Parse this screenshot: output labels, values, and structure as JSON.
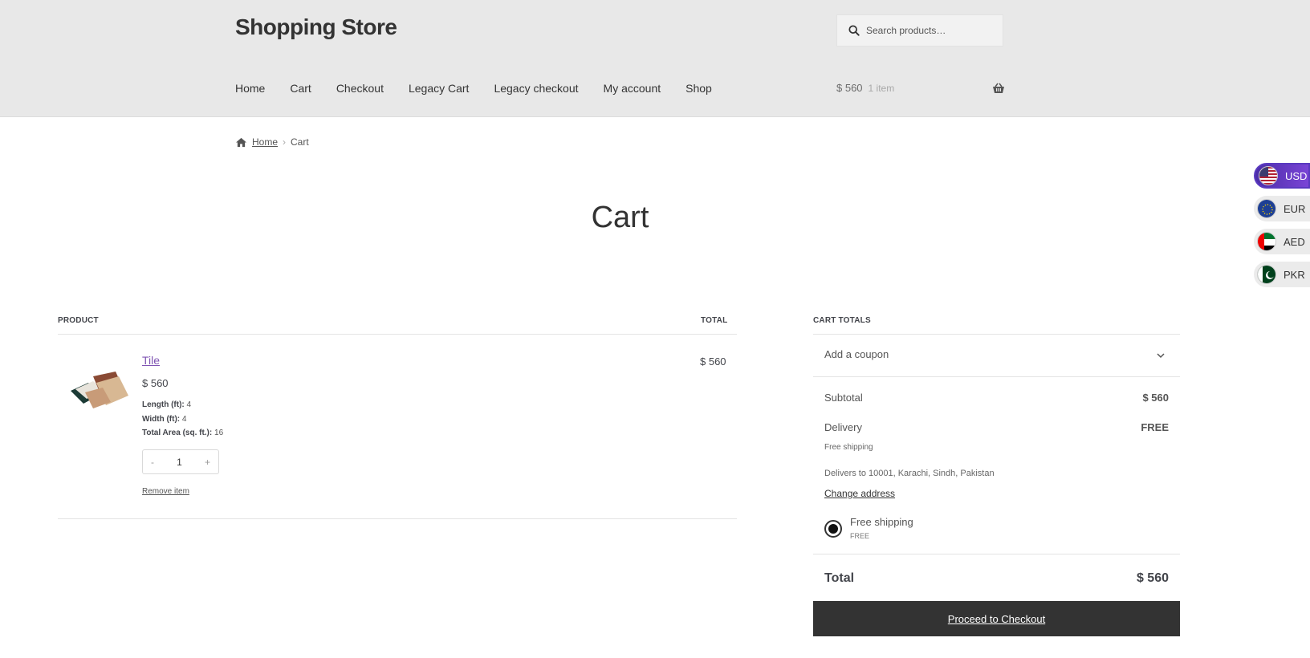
{
  "site": {
    "title": "Shopping Store"
  },
  "search": {
    "placeholder": "Search products…"
  },
  "nav": [
    "Home",
    "Cart",
    "Checkout",
    "Legacy Cart",
    "Legacy checkout",
    "My account",
    "Shop"
  ],
  "mini_cart": {
    "amount": "$ 560",
    "count": "1 item"
  },
  "breadcrumb": {
    "home": "Home",
    "current": "Cart"
  },
  "page": {
    "title": "Cart"
  },
  "currencies": [
    {
      "code": "USD",
      "active": true
    },
    {
      "code": "EUR",
      "active": false
    },
    {
      "code": "AED",
      "active": false
    },
    {
      "code": "PKR",
      "active": false
    }
  ],
  "cart": {
    "col_product": "PRODUCT",
    "col_total": "TOTAL",
    "item": {
      "name": "Tile",
      "price": "$ 560",
      "meta": [
        {
          "label": "Length (ft):",
          "value": "4"
        },
        {
          "label": "Width (ft):",
          "value": "4"
        },
        {
          "label": "Total Area (sq. ft.):",
          "value": "16"
        }
      ],
      "qty_minus": "-",
      "quantity": "1",
      "qty_plus": "+",
      "remove": "Remove item",
      "line_total": "$ 560"
    }
  },
  "totals": {
    "heading": "CART TOTALS",
    "coupon": "Add a coupon",
    "subtotal_label": "Subtotal",
    "subtotal_value": "$ 560",
    "delivery_label": "Delivery",
    "delivery_value": "FREE",
    "delivery_method": "Free shipping",
    "delivers_to": "Delivers to 10001, Karachi, Sindh, Pakistan",
    "change_address": "Change address",
    "shipping_option_name": "Free shipping",
    "shipping_option_cost": "FREE",
    "total_label": "Total",
    "total_value": "$ 560",
    "checkout": "Proceed to Checkout"
  }
}
